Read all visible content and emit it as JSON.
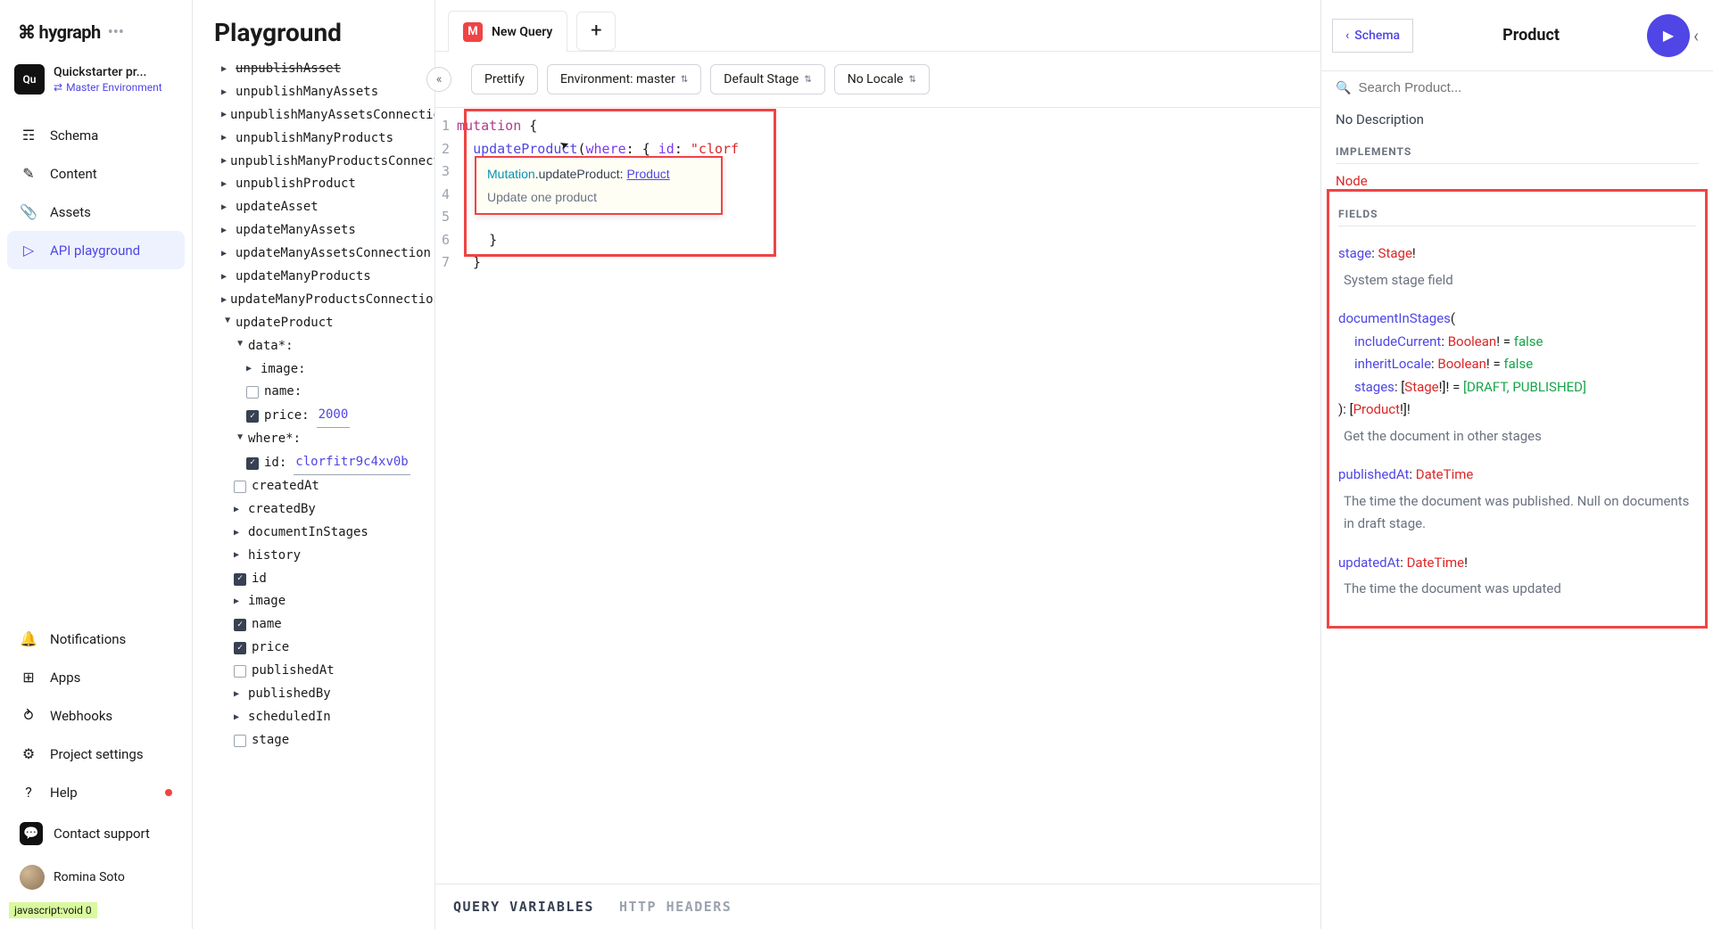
{
  "brand": "hygraph",
  "project": {
    "badge": "Qu",
    "name": "Quickstarter pr...",
    "env": "Master Environment"
  },
  "nav": {
    "schema": "Schema",
    "content": "Content",
    "assets": "Assets",
    "api_playground": "API playground",
    "notifications": "Notifications",
    "apps": "Apps",
    "webhooks": "Webhooks",
    "project_settings": "Project settings",
    "help": "Help",
    "contact_support": "Contact support"
  },
  "user": {
    "name": "Romina Soto"
  },
  "status_text": "javascript:void 0",
  "explorer": {
    "title": "Playground",
    "items": [
      {
        "label": "unpublishAsset",
        "level": 1,
        "tri": "right",
        "strike": true
      },
      {
        "label": "unpublishManyAssets",
        "level": 1,
        "tri": "right"
      },
      {
        "label": "unpublishManyAssetsConnection",
        "level": 1,
        "tri": "right"
      },
      {
        "label": "unpublishManyProducts",
        "level": 1,
        "tri": "right"
      },
      {
        "label": "unpublishManyProductsConnecti",
        "level": 1,
        "tri": "right"
      },
      {
        "label": "unpublishProduct",
        "level": 1,
        "tri": "right"
      },
      {
        "label": "updateAsset",
        "level": 1,
        "tri": "right"
      },
      {
        "label": "updateManyAssets",
        "level": 1,
        "tri": "right"
      },
      {
        "label": "updateManyAssetsConnection",
        "level": 1,
        "tri": "right"
      },
      {
        "label": "updateManyProducts",
        "level": 1,
        "tri": "right"
      },
      {
        "label": "updateManyProductsConnection",
        "level": 1,
        "tri": "right"
      },
      {
        "label": "updateProduct",
        "level": 1,
        "tri": "down"
      },
      {
        "label": "data*:",
        "level": 2,
        "tri": "down"
      },
      {
        "label": "image:",
        "level": 3,
        "tri": "right"
      },
      {
        "label": "name:",
        "level": 3,
        "chk": false
      },
      {
        "label": "price:",
        "level": 3,
        "chk": true,
        "val": "2000"
      },
      {
        "label": "where*:",
        "level": 2,
        "tri": "down"
      },
      {
        "label": "id:",
        "level": 3,
        "chk": true,
        "val": "clorfitr9c4xv0b"
      },
      {
        "label": "createdAt",
        "level": 2,
        "chk": false
      },
      {
        "label": "createdBy",
        "level": 2,
        "tri": "right"
      },
      {
        "label": "documentInStages",
        "level": 2,
        "tri": "right"
      },
      {
        "label": "history",
        "level": 2,
        "tri": "right"
      },
      {
        "label": "id",
        "level": 2,
        "chk": true
      },
      {
        "label": "image",
        "level": 2,
        "tri": "right"
      },
      {
        "label": "name",
        "level": 2,
        "chk": true
      },
      {
        "label": "price",
        "level": 2,
        "chk": true
      },
      {
        "label": "publishedAt",
        "level": 2,
        "chk": false
      },
      {
        "label": "publishedBy",
        "level": 2,
        "tri": "right"
      },
      {
        "label": "scheduledIn",
        "level": 2,
        "tri": "right"
      },
      {
        "label": "stage",
        "level": 2,
        "chk": false
      }
    ]
  },
  "tabs": {
    "badge": "M",
    "label": "New Query"
  },
  "toolbar": {
    "prettify": "Prettify",
    "environment": "Environment: master",
    "stage": "Default Stage",
    "locale": "No Locale"
  },
  "code": {
    "lines": [
      "1",
      "2",
      "3",
      "4",
      "5",
      "6",
      "7"
    ],
    "l1_kw": "mutation",
    "l1_brace": " {",
    "l2_fn": "updateProduct",
    "l2_paren": "(",
    "l2_arg1": "where",
    "l2_sep1": ": { ",
    "l2_arg2": "id",
    "l2_sep2": ": ",
    "l2_str": "\"clorf",
    "l6": "    }",
    "l7": "  }"
  },
  "hover": {
    "prefix": "Mutation",
    "dot": ".",
    "name": "updateProduct",
    "colon": ": ",
    "type": "Product",
    "desc": "Update one product"
  },
  "bottom_tabs": {
    "vars": "QUERY VARIABLES",
    "headers": "HTTP HEADERS"
  },
  "docs": {
    "schema_btn": "Schema",
    "title": "Product",
    "search_placeholder": "Search Product...",
    "no_desc": "No Description",
    "implements": "IMPLEMENTS",
    "implements_link": "Node",
    "fields_label": "FIELDS",
    "f1": {
      "name": "stage",
      "type": "Stage",
      "desc": "System stage field"
    },
    "f2": {
      "name": "documentInStages",
      "a1_name": "includeCurrent",
      "a1_type": "Boolean",
      "a1_val": "false",
      "a2_name": "inheritLocale",
      "a2_type": "Boolean",
      "a2_val": "false",
      "a3_name": "stages",
      "a3_type": "Stage",
      "a3_val": "[DRAFT, PUBLISHED]",
      "ret": "Product",
      "desc": "Get the document in other stages"
    },
    "f3": {
      "name": "publishedAt",
      "type": "DateTime",
      "desc": "The time the document was published. Null on documents in draft stage."
    },
    "f4": {
      "name": "updatedAt",
      "type": "DateTime",
      "desc": "The time the document was updated"
    }
  }
}
